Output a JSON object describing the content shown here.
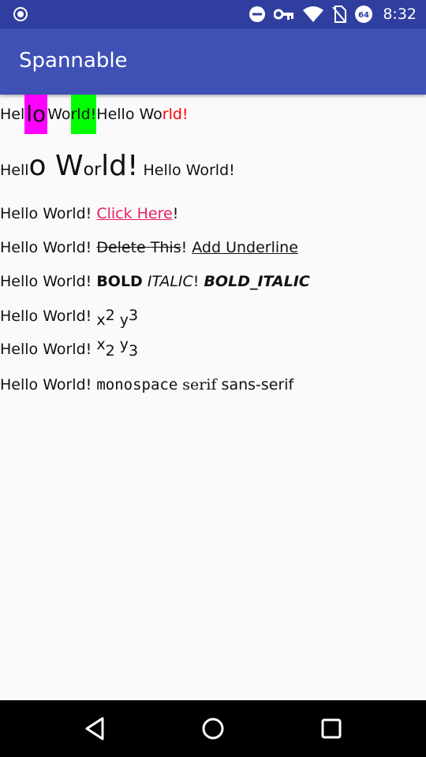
{
  "status_bar": {
    "time": "8:32",
    "battery_level": "64"
  },
  "app_bar": {
    "title": "Spannable"
  },
  "lines": {
    "l1": {
      "a": "Hel",
      "b": "lo",
      "c": " Wo",
      "d": "rld!",
      "e": " Hello Wo",
      "f": "rld!"
    },
    "l2": {
      "a": "Hell",
      "b": "o W",
      "c": "or",
      "d": "ld!",
      "e": " Hello World!"
    },
    "l3": {
      "a": "Hello World! ",
      "b": "Click Here",
      "c": "!"
    },
    "l4": {
      "a": "Hello World! ",
      "b": "Delete This",
      "c": "! ",
      "d": "Add Underline"
    },
    "l5": {
      "a": "Hello World! ",
      "b": "BOLD",
      "c": " ",
      "d": "ITALIC",
      "e": "! ",
      "f": "BOLD_ITALIC"
    },
    "l6": {
      "a": "Hello World! ",
      "b": "x",
      "c": "2",
      "d": " y",
      "e": "3"
    },
    "l7": {
      "a": "Hello World! ",
      "b": "x",
      "c": "2",
      "d": " y",
      "e": "3"
    },
    "l8": {
      "a": "Hello World! ",
      "b": "monospace",
      "c": " serif",
      "d": " sans-serif"
    }
  },
  "colors": {
    "status_bar": "#303f9f",
    "app_bar": "#3f51b5",
    "highlight_magenta": "#ff00ff",
    "highlight_green": "#00ff00",
    "red_text": "#ff0000",
    "link": "#e91e63"
  },
  "icons": {
    "status_left": "app-notification-icon",
    "status_right": [
      "do-not-disturb-icon",
      "vpn-key-icon",
      "wifi-icon",
      "no-sim-icon",
      "battery-icon"
    ],
    "nav": [
      "back-icon",
      "home-icon",
      "recents-icon"
    ]
  }
}
